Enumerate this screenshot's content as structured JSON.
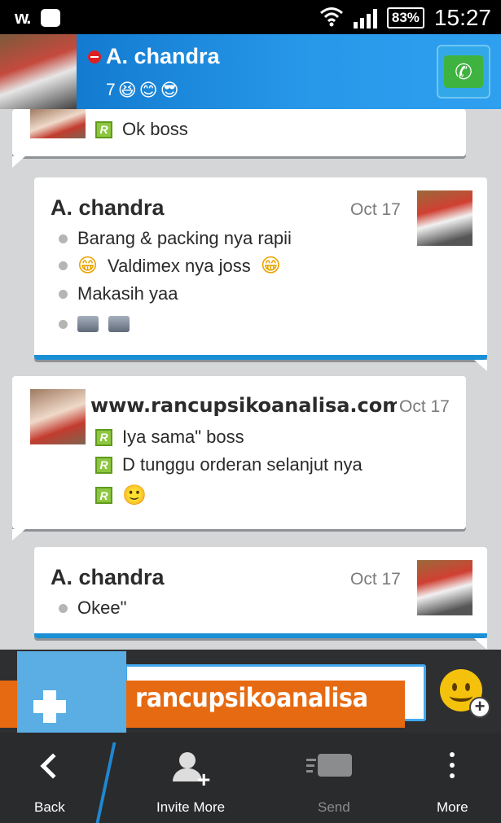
{
  "status_bar": {
    "battery": "83%",
    "time": "15:27"
  },
  "header": {
    "contact_name": "A. chandra",
    "status_count": "7",
    "status_emoticons": [
      "😆",
      "😊",
      "😎"
    ]
  },
  "messages": [
    {
      "sender": "",
      "lines": [
        {
          "marker": "r-icon",
          "text": "Ok  boss"
        }
      ]
    },
    {
      "sender": "A. chandra",
      "date": "Oct 17",
      "lines": [
        {
          "marker": "dot",
          "text": "Barang & packing nya rapii"
        },
        {
          "marker": "dot",
          "text": "Valdimex nya joss",
          "emoji_before": "😁",
          "emoji_after": "😁"
        },
        {
          "marker": "dot",
          "text": "Makasih yaa"
        },
        {
          "marker": "dot",
          "text": "",
          "icons": [
            "thumbs-up-icon",
            "thumbs-up-icon"
          ]
        }
      ]
    },
    {
      "sender": "www.rancupsikoanalisa.com",
      "date": "Oct 17",
      "lines": [
        {
          "marker": "r-icon",
          "text": "Iya sama\" boss"
        },
        {
          "marker": "r-icon",
          "text": "D tunggu orderan selanjut nya"
        },
        {
          "marker": "r-icon",
          "text": "",
          "emoji": "🙂"
        }
      ]
    },
    {
      "sender": "A. chandra",
      "date": "Oct 17",
      "lines": [
        {
          "marker": "dot",
          "text": "Okee\""
        }
      ]
    }
  ],
  "input": {
    "watermark": "rancupsikoanalisa"
  },
  "bottom_nav": {
    "back": "Back",
    "invite_more": "Invite More",
    "send": "Send",
    "more": "More"
  },
  "colors": {
    "header_blue": "#1a8fd6",
    "accent_orange": "#e66a12",
    "call_green": "#3fb33f",
    "r_icon_green": "#8dc63f"
  }
}
